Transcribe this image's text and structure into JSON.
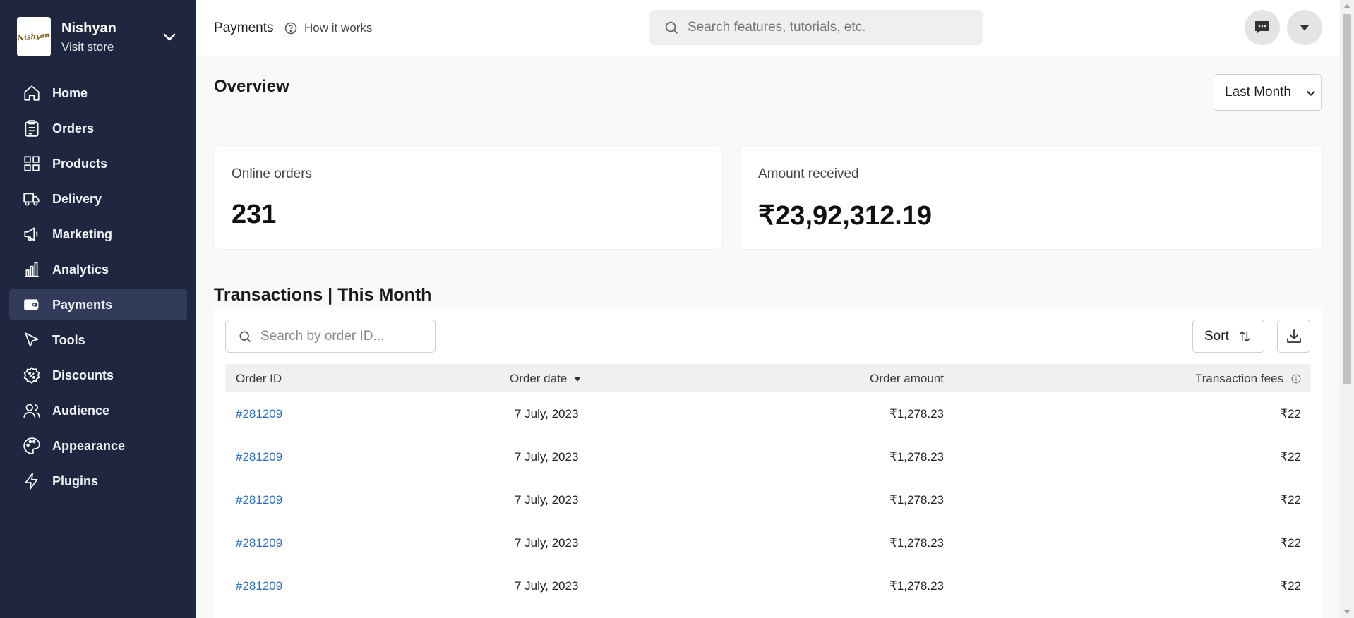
{
  "store": {
    "name": "Nishyan",
    "visit_label": "Visit store",
    "logo_text": "Nishyan"
  },
  "sidebar": {
    "items": [
      {
        "label": "Home",
        "icon": "home-icon"
      },
      {
        "label": "Orders",
        "icon": "orders-icon"
      },
      {
        "label": "Products",
        "icon": "grid-icon"
      },
      {
        "label": "Delivery",
        "icon": "truck-icon"
      },
      {
        "label": "Marketing",
        "icon": "megaphone-icon"
      },
      {
        "label": "Analytics",
        "icon": "bar-chart-icon"
      },
      {
        "label": "Payments",
        "icon": "wallet-icon",
        "active": true
      },
      {
        "label": "Tools",
        "icon": "cursor-icon"
      },
      {
        "label": "Discounts",
        "icon": "discount-icon"
      },
      {
        "label": "Audience",
        "icon": "users-icon"
      },
      {
        "label": "Appearance",
        "icon": "palette-icon"
      },
      {
        "label": "Plugins",
        "icon": "bolt-icon"
      }
    ]
  },
  "header": {
    "title": "Payments",
    "how_it_works": "How it works",
    "search_placeholder": "Search features, tutorials, etc."
  },
  "overview": {
    "title": "Overview",
    "range_selected": "Last Month",
    "cards": [
      {
        "label": "Online orders",
        "value": "231"
      },
      {
        "label": "Amount received",
        "value": "₹23,92,312.19"
      }
    ]
  },
  "transactions": {
    "title": "Transactions | This Month",
    "search_placeholder": "Search by order ID...",
    "sort_label": "Sort",
    "columns": [
      "Order ID",
      "Order date",
      "Order amount",
      "Transaction fees"
    ],
    "rows": [
      {
        "id": "#281209",
        "date": "7 July, 2023",
        "amount": "₹1,278.23",
        "fees": "₹22"
      },
      {
        "id": "#281209",
        "date": "7 July, 2023",
        "amount": "₹1,278.23",
        "fees": "₹22"
      },
      {
        "id": "#281209",
        "date": "7 July, 2023",
        "amount": "₹1,278.23",
        "fees": "₹22"
      },
      {
        "id": "#281209",
        "date": "7 July, 2023",
        "amount": "₹1,278.23",
        "fees": "₹22"
      },
      {
        "id": "#281209",
        "date": "7 July, 2023",
        "amount": "₹1,278.23",
        "fees": "₹22"
      }
    ]
  },
  "colors": {
    "sidebar_bg": "#1e2640",
    "sidebar_active": "#323c5a",
    "link": "#2a6fc4"
  }
}
